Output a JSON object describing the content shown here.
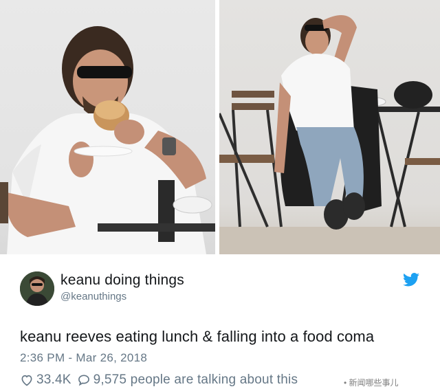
{
  "tweet": {
    "display_name": "keanu doing things",
    "handle": "@keanuthings",
    "text": "keanu reeves eating lunch & falling into a food coma",
    "timestamp": "2:36 PM - Mar 26, 2018",
    "likes": "33.4K",
    "talking": "9,575 people are talking about this"
  },
  "watermark": "• 新闻哪些事儿",
  "icons": {
    "brand": "twitter-bird-icon",
    "like": "heart-icon",
    "reply": "speech-bubble-icon"
  },
  "colors": {
    "twitter_blue": "#1da1f2",
    "text": "#14171a",
    "secondary": "#657786"
  }
}
